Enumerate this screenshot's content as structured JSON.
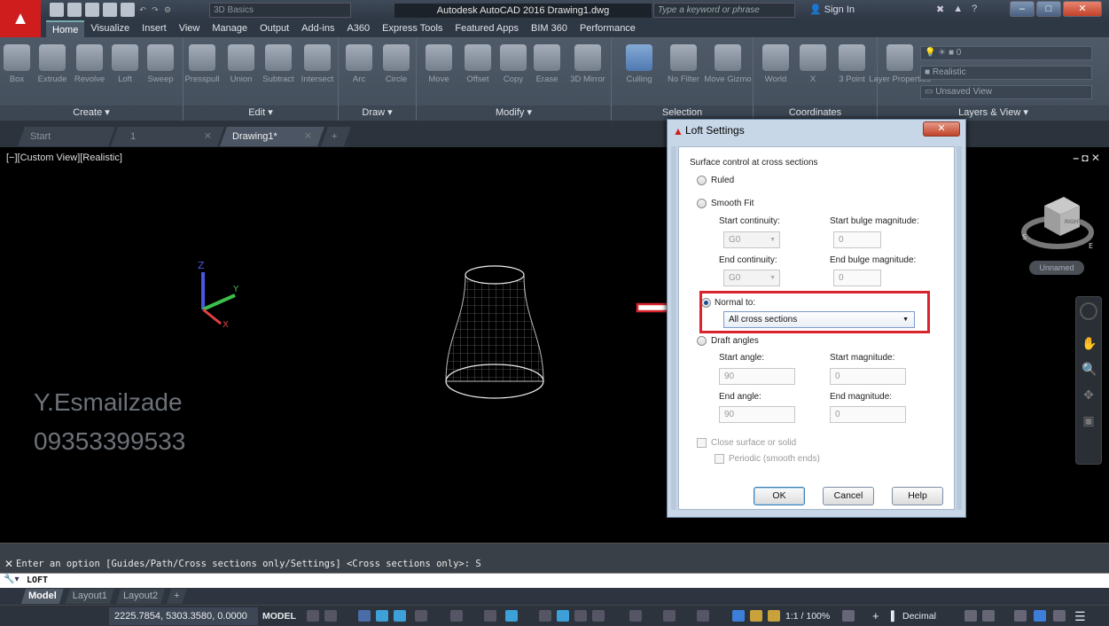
{
  "window": {
    "app_title": "Autodesk AutoCAD 2016    Drawing1.dwg",
    "workspace_combo": "3D Basics",
    "search_placeholder": "Type a keyword or phrase",
    "sign_in": "Sign In"
  },
  "ribbon": {
    "tabs": [
      "Home",
      "Visualize",
      "Insert",
      "View",
      "Manage",
      "Output",
      "Add-ins",
      "A360",
      "Express Tools",
      "Featured Apps",
      "BIM 360",
      "Performance"
    ],
    "active_tab": "Home",
    "create": {
      "label": "Create ▾",
      "tools": [
        "Box",
        "Extrude",
        "Revolve",
        "Loft",
        "Sweep"
      ]
    },
    "edit": {
      "label": "Edit ▾",
      "tools": [
        "Presspull",
        "Union",
        "Subtract",
        "Intersect"
      ]
    },
    "draw": {
      "label": "Draw ▾",
      "tools": [
        "Arc",
        "Circle"
      ]
    },
    "modify": {
      "label": "Modify ▾",
      "tools": [
        "Move",
        "Offset",
        "Copy",
        "Erase",
        "3D Mirror"
      ]
    },
    "selection": {
      "label": "Selection",
      "tools": [
        "Culling",
        "No Filter",
        "Move Gizmo"
      ]
    },
    "coordinates": {
      "label": "Coordinates",
      "tools": [
        "World",
        "X",
        "3 Point"
      ]
    },
    "layers": {
      "label": "Layers & View ▾",
      "tool": "Layer Properties",
      "visual_style": "Realistic",
      "view": "Unsaved View",
      "layer_name": "0"
    }
  },
  "doc_tabs": {
    "start": "Start",
    "tab1": "1",
    "drawing": "Drawing1*"
  },
  "viewport": {
    "label": "[−][Custom View][Realistic]",
    "watermark_name": "Y.Esmailzade",
    "watermark_phone": "09353399533",
    "viewcube_label": "Unnamed",
    "viewcube_face": "RIGHT"
  },
  "dialog": {
    "title": "Loft Settings",
    "section": "Surface control at cross sections",
    "ruled": "Ruled",
    "smooth_fit": "Smooth Fit",
    "start_continuity": "Start continuity:",
    "start_continuity_value": "G0",
    "start_bulge": "Start bulge magnitude:",
    "start_bulge_value": "0",
    "end_continuity": "End continuity:",
    "end_continuity_value": "G0",
    "end_bulge": "End bulge magnitude:",
    "end_bulge_value": "0",
    "normal_to": "Normal to:",
    "normal_to_value": "All cross sections",
    "draft_angles": "Draft angles",
    "start_angle": "Start angle:",
    "start_angle_value": "90",
    "start_magnitude": "Start magnitude:",
    "start_magnitude_value": "0",
    "end_angle": "End angle:",
    "end_angle_value": "90",
    "end_magnitude": "End magnitude:",
    "end_magnitude_value": "0",
    "close_surface": "Close surface or solid",
    "periodic": "Periodic (smooth ends)",
    "ok": "OK",
    "cancel": "Cancel",
    "help": "Help"
  },
  "command": {
    "history": "Enter an option [Guides/Path/Cross sections only/Settings] <Cross sections only>: S",
    "prompt": "LOFT"
  },
  "layout_tabs": [
    "Model",
    "Layout1",
    "Layout2"
  ],
  "status": {
    "coords": "2225.7854, 5303.3580, 0.0000",
    "model": "MODEL",
    "scale": "1:1 / 100%",
    "units": "Decimal"
  },
  "colors": {
    "highlight": "#d9232d",
    "brand_red": "#cf1d1d"
  }
}
